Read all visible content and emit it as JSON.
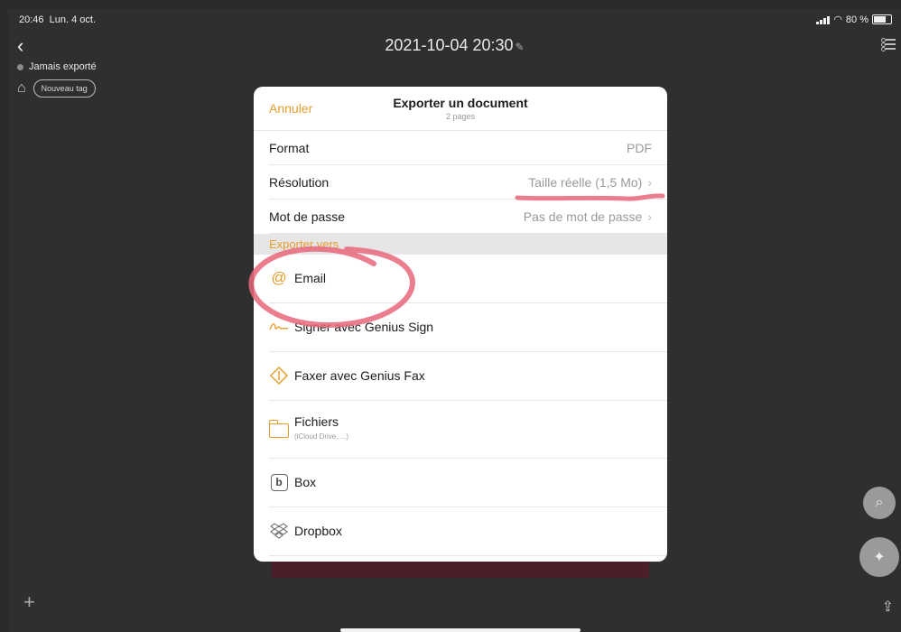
{
  "status_bar": {
    "time": "20:46",
    "date": "Lun. 4 oct.",
    "battery": "80 %"
  },
  "document": {
    "title": "2021-10-04 20:30",
    "export_status": "Jamais exporté",
    "new_tag_label": "Nouveau tag"
  },
  "sheet": {
    "cancel_label": "Annuler",
    "title": "Exporter un document",
    "subtitle": "2 pages",
    "settings": [
      {
        "label": "Format",
        "value": "PDF"
      },
      {
        "label": "Résolution",
        "value": "Taille réelle (1,5 Mo)"
      },
      {
        "label": "Mot de passe",
        "value": "Pas de mot de passe"
      }
    ],
    "section_label": "Exporter vers",
    "destinations": [
      {
        "label": "Email",
        "icon": "at-icon"
      },
      {
        "label": "Signer avec Genius Sign",
        "icon": "signature-icon"
      },
      {
        "label": "Faxer avec Genius Fax",
        "icon": "fax-icon"
      },
      {
        "label": "Fichiers",
        "sub": "(iCloud Drive, ...)",
        "icon": "folder-icon"
      },
      {
        "label": "Box",
        "icon": "box-icon"
      },
      {
        "label": "Dropbox",
        "icon": "dropbox-icon"
      }
    ]
  },
  "colors": {
    "accent": "#e59d2f",
    "annotation": "#e8677a",
    "background": "#2f2f2f"
  }
}
